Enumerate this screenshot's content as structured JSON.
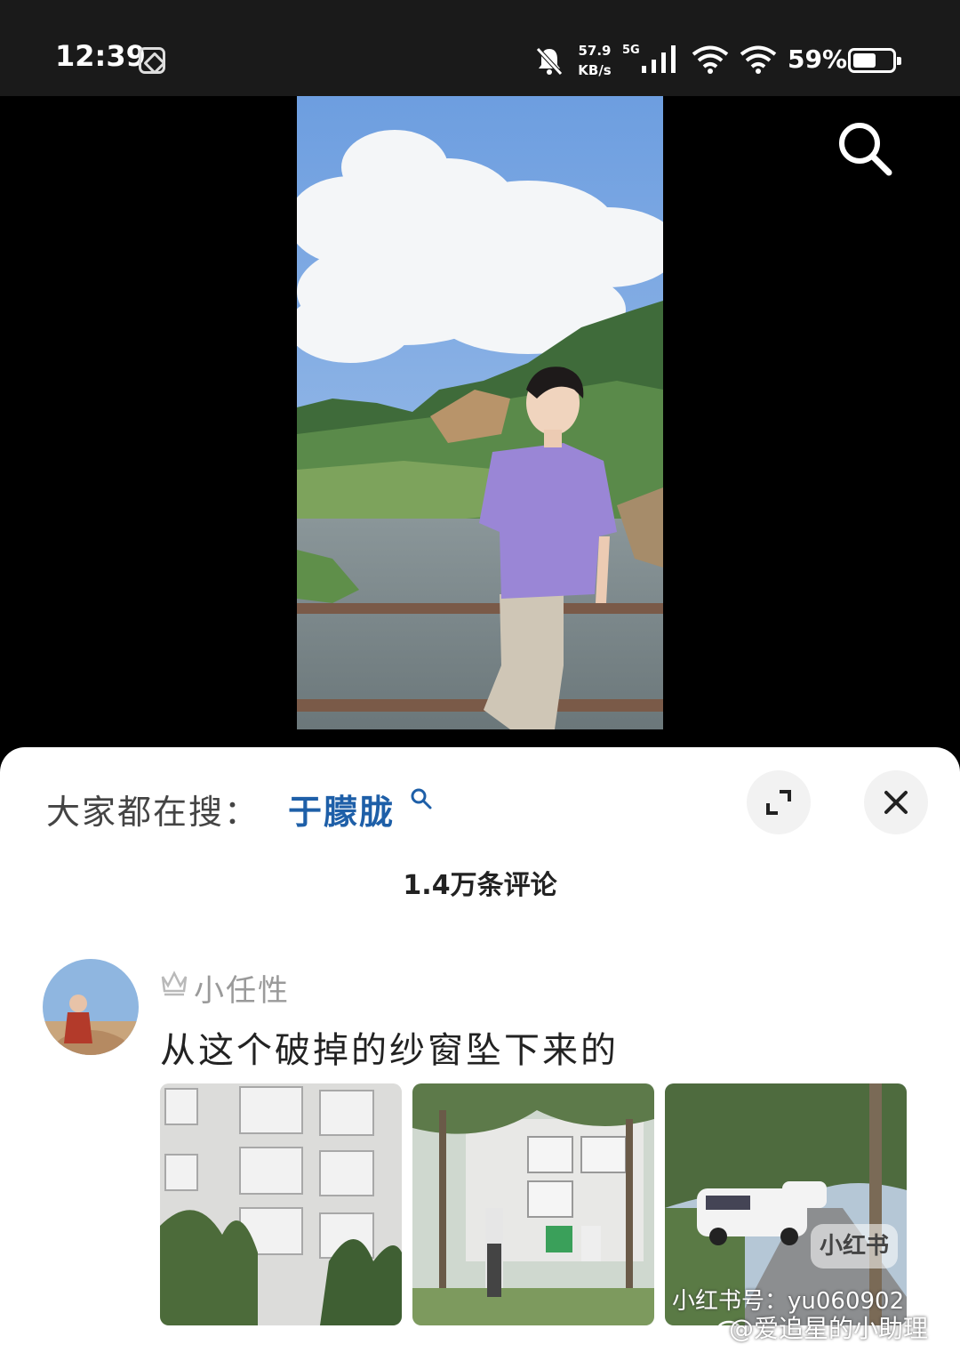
{
  "status_bar": {
    "time": "12:39",
    "net_speed_value": "57.9",
    "net_speed_unit": "KB/s",
    "network_type": "5G",
    "battery_percent": "59%",
    "battery_level": 0.59,
    "icons": [
      "screenshot-app-icon",
      "bell-muted-icon",
      "signal-icon",
      "wifi-icon",
      "wifi-icon",
      "battery-icon"
    ]
  },
  "video": {
    "search_icon": "search-icon"
  },
  "comments_panel": {
    "trending_label": "大家都在搜：",
    "trending_term": "于朦胧",
    "comment_count": "1.4万条评论",
    "expand_icon": "expand-icon",
    "close_icon": "close-icon",
    "comments": [
      {
        "username": "小任性",
        "badge_icon": "crown-icon",
        "text": "从这个破掉的纱窗坠下来的"
      }
    ]
  },
  "watermarks": {
    "badge": "小红书",
    "id_line": "小红书号：yu060902",
    "weibo_line": "@爱追星的小助理"
  }
}
